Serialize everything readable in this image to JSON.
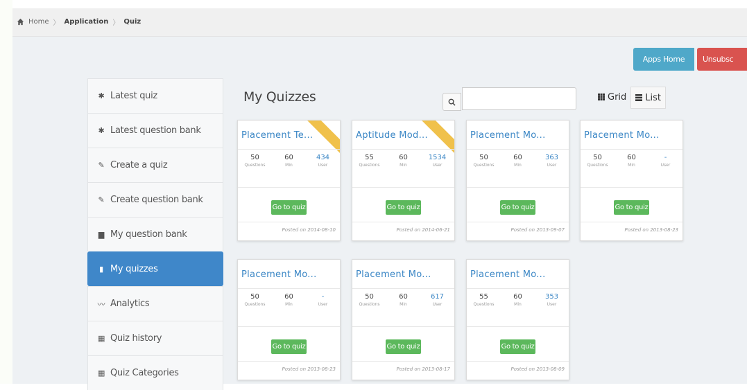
{
  "breadcrumb": {
    "items": [
      "Home",
      "Application",
      "Quiz"
    ]
  },
  "top_buttons": {
    "apps_home": "Apps Home",
    "unsubscribe": "Unsubsc"
  },
  "sidebar": {
    "items": [
      {
        "label": "Latest quiz",
        "icon": "star-icon",
        "glyph": "✱"
      },
      {
        "label": "Latest question bank",
        "icon": "star-icon",
        "glyph": "✱"
      },
      {
        "label": "Create a quiz",
        "icon": "edit-icon",
        "glyph": "✎"
      },
      {
        "label": "Create question bank",
        "icon": "edit-icon",
        "glyph": "✎"
      },
      {
        "label": "My question bank",
        "icon": "book-icon",
        "glyph": "▆"
      },
      {
        "label": "My quizzes",
        "icon": "file-icon",
        "glyph": "▮",
        "active": true
      },
      {
        "label": "Analytics",
        "icon": "chart-icon",
        "glyph": "〰"
      },
      {
        "label": "Quiz history",
        "icon": "history-icon",
        "glyph": "▦"
      },
      {
        "label": "Quiz Categories",
        "icon": "categories-icon",
        "glyph": "▦"
      }
    ]
  },
  "main": {
    "title": "My Quizzes",
    "search_value": "",
    "view_grid": "Grid",
    "view_list": "List"
  },
  "cards": [
    {
      "title": "Placement Te...",
      "ribbon": true,
      "questions": "50",
      "min": "60",
      "users": "434",
      "cta": "Go to quiz",
      "posted": "Posted on 2014-08-10"
    },
    {
      "title": "Aptitude Mod...",
      "ribbon": true,
      "questions": "55",
      "min": "60",
      "users": "1534",
      "cta": "Go to quiz",
      "posted": "Posted on 2014-06-21"
    },
    {
      "title": "Placement Mo...",
      "ribbon": false,
      "questions": "50",
      "min": "60",
      "users": "363",
      "cta": "Go to quiz",
      "posted": "Posted on 2013-09-07"
    },
    {
      "title": "Placement Mo...",
      "ribbon": false,
      "questions": "50",
      "min": "60",
      "users": "-",
      "cta": "Go to quiz",
      "posted": "Posted on 2013-08-23"
    },
    {
      "title": "Placement Mo...",
      "ribbon": false,
      "questions": "50",
      "min": "60",
      "users": "-",
      "cta": "Go to quiz",
      "posted": "Posted on 2013-08-23"
    },
    {
      "title": "Placement Mo...",
      "ribbon": false,
      "questions": "50",
      "min": "60",
      "users": "617",
      "cta": "Go to quiz",
      "posted": "Posted on 2013-08-17"
    },
    {
      "title": "Placement Mo...",
      "ribbon": false,
      "questions": "55",
      "min": "60",
      "users": "353",
      "cta": "Go to quiz",
      "posted": "Posted on 2013-08-09"
    }
  ],
  "stat_labels": {
    "questions": "Questions",
    "min": "Min",
    "users": "User"
  },
  "colors": {
    "accent": "#3f87c9",
    "success": "#5cb85c",
    "info": "#4fa8c9",
    "danger": "#d9534f"
  }
}
